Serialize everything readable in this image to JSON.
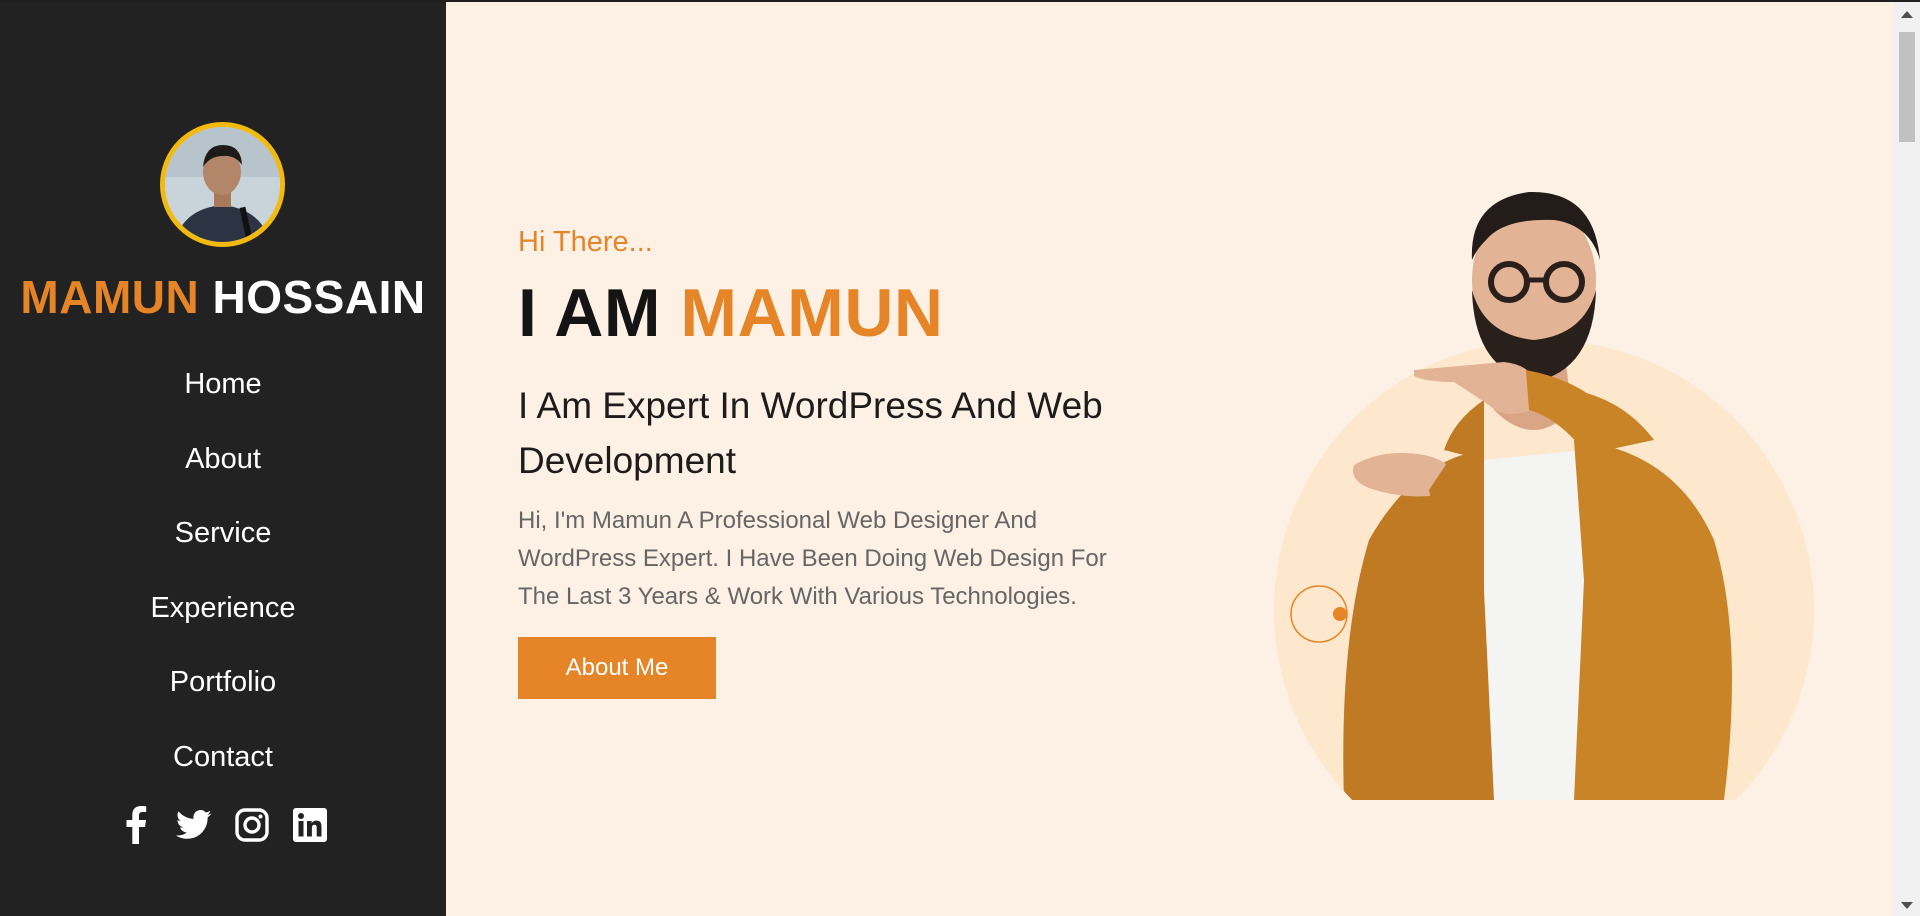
{
  "sidebar": {
    "brand": {
      "first": "MAMUN",
      "last": "HOSSAIN"
    },
    "avatar_icon": "profile-photo",
    "nav": [
      {
        "label": "Home"
      },
      {
        "label": "About"
      },
      {
        "label": "Service"
      },
      {
        "label": "Experience"
      },
      {
        "label": "Portfolio"
      },
      {
        "label": "Contact"
      }
    ],
    "social": [
      "facebook-icon",
      "twitter-icon",
      "instagram-icon",
      "linkedin-icon"
    ]
  },
  "hero": {
    "greeting": "Hi There...",
    "headline_prefix": "I AM",
    "headline_name": "MAMUN",
    "subtitle": "I Am Expert In WordPress And Web Development",
    "description": "Hi, I'm Mamun A Professional Web Designer And WordPress Expert. I Have Been Doing Web Design For The Last 3 Years & Work With Various Technologies.",
    "button_label": "About Me",
    "image_icon": "man-pointing-illustration"
  },
  "colors": {
    "accent": "#e58527",
    "sidebar_bg": "#222222",
    "page_bg": "#fdf1e6",
    "avatar_ring": "#f2b90f"
  }
}
